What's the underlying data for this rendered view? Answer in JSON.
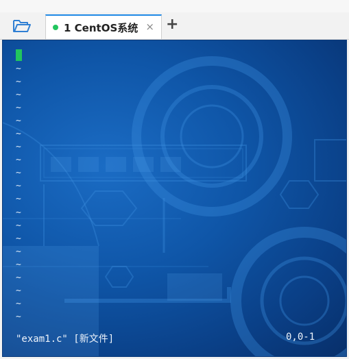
{
  "tabs": [
    {
      "label": "1  CentOS系统",
      "status_color": "#22c55e",
      "close_glyph": "×"
    }
  ],
  "add_tab_glyph": "+",
  "terminal": {
    "cursor_color": "#22c55e",
    "tilde_rows": 20,
    "tilde_char": "~",
    "status_file": "\"exam1.c\" [新文件]",
    "status_position": "0,0-1"
  },
  "icons": {
    "open": "folder-open-icon",
    "close": "close-icon",
    "add": "plus-icon"
  }
}
